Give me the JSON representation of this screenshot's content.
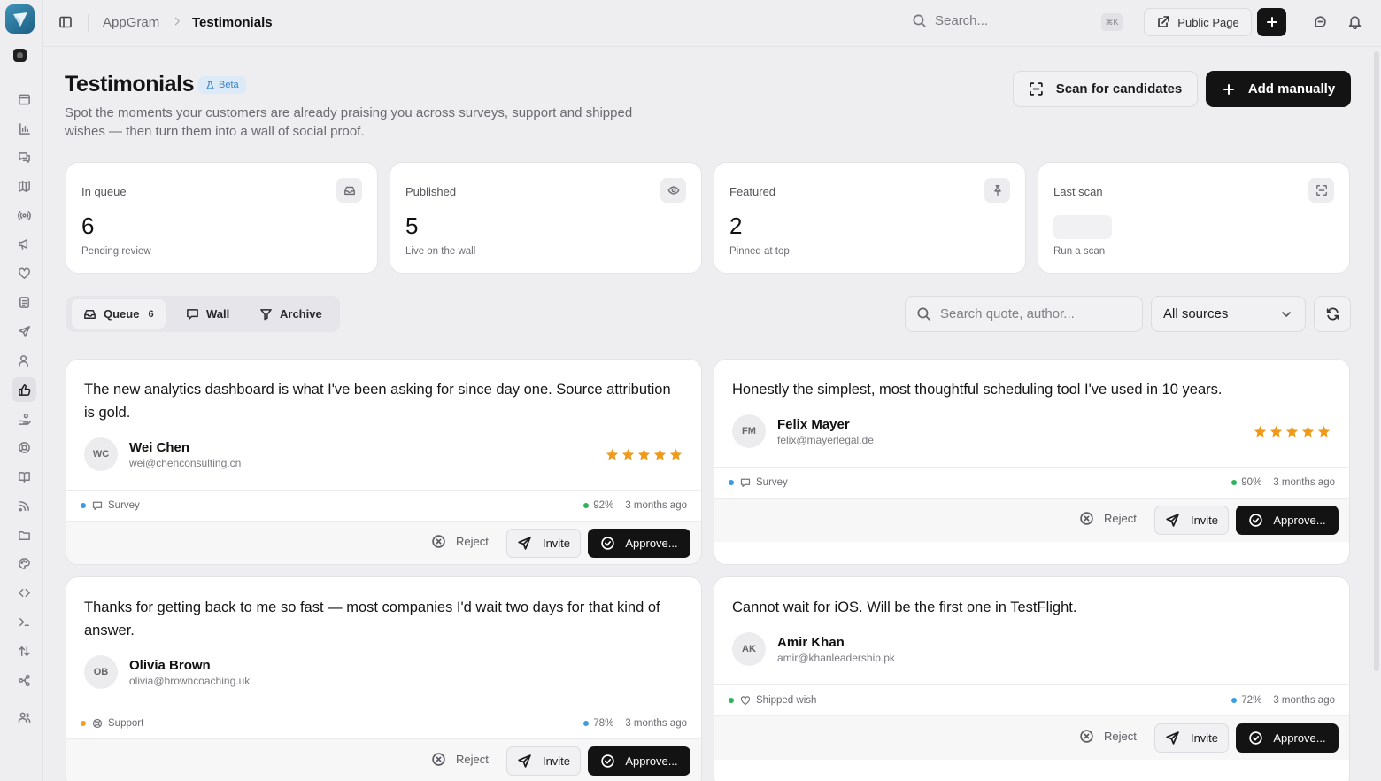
{
  "app": {
    "name": "AppGram"
  },
  "breadcrumb": {
    "root": "AppGram",
    "current": "Testimonials"
  },
  "topbar": {
    "search_placeholder": "Search...",
    "shortcut": "⌘K",
    "public_page_label": "Public Page"
  },
  "header": {
    "title": "Testimonials",
    "badge": "Beta",
    "subtitle": "Spot the moments your customers are already praising you across surveys, support and shipped wishes — then turn them into a wall of social proof.",
    "scan_label": "Scan for candidates",
    "add_label": "Add manually"
  },
  "stats": [
    {
      "label": "In queue",
      "value": "6",
      "sub": "Pending review",
      "icon": "inbox-icon"
    },
    {
      "label": "Published",
      "value": "5",
      "sub": "Live on the wall",
      "icon": "eye-icon"
    },
    {
      "label": "Featured",
      "value": "2",
      "sub": "Pinned at top",
      "icon": "pin-icon"
    },
    {
      "label": "Last scan",
      "value": "",
      "sub": "Run a scan",
      "icon": "scan-icon"
    }
  ],
  "tabs": [
    {
      "label": "Queue",
      "count": "6"
    },
    {
      "label": "Wall"
    },
    {
      "label": "Archive"
    }
  ],
  "filters": {
    "search_placeholder": "Search quote, author...",
    "source_selected": "All sources"
  },
  "actions": {
    "reject": "Reject",
    "invite": "Invite",
    "approve": "Approve..."
  },
  "testimonials": [
    {
      "quote": "The new analytics dashboard is what I've been asking for since day one. Source attribution is gold.",
      "initials": "WC",
      "name": "Wei Chen",
      "email": "wei@chenconsulting.cn",
      "rating": 5,
      "source": "Survey",
      "source_color": "#3b9be0",
      "score": "92%",
      "score_color": "#2fb35a",
      "ago": "3 months ago"
    },
    {
      "quote": "Honestly the simplest, most thoughtful scheduling tool I've used in 10 years.",
      "initials": "FM",
      "name": "Felix Mayer",
      "email": "felix@mayerlegal.de",
      "rating": 5,
      "source": "Survey",
      "source_color": "#3b9be0",
      "score": "90%",
      "score_color": "#2fb35a",
      "ago": "3 months ago"
    },
    {
      "quote": "Thanks for getting back to me so fast — most companies I'd wait two days for that kind of answer.",
      "initials": "OB",
      "name": "Olivia Brown",
      "email": "olivia@browncoaching.uk",
      "rating": 0,
      "source": "Support",
      "source_color": "#f0a020",
      "score": "78%",
      "score_color": "#3b9be0",
      "ago": "3 months ago"
    },
    {
      "quote": "Cannot wait for iOS. Will be the first one in TestFlight.",
      "initials": "AK",
      "name": "Amir Khan",
      "email": "amir@khanleadership.pk",
      "rating": 0,
      "source": "Shipped wish",
      "source_color": "#2fb35a",
      "score": "72%",
      "score_color": "#3b9be0",
      "ago": "3 months ago"
    }
  ]
}
